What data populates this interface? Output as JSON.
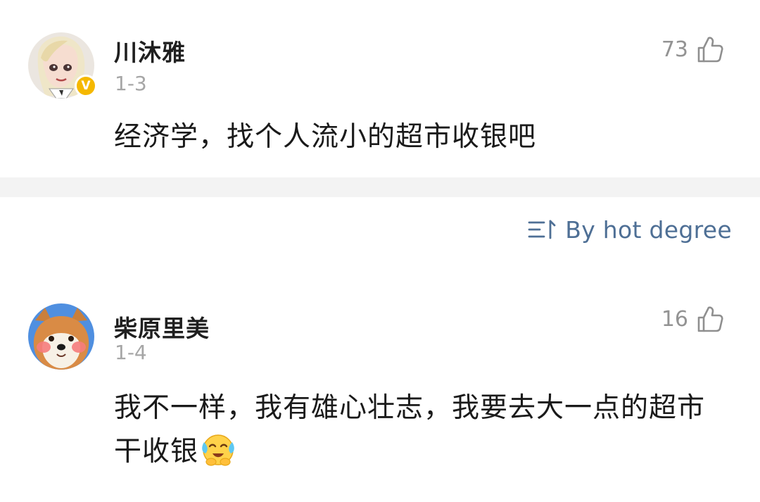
{
  "comments": [
    {
      "username": "川沐雅",
      "date": "1-3",
      "likes": "73",
      "verified_badge": "V",
      "content": "经济学，找个人流小的超市收银吧",
      "avatar": "anime-girl-avatar",
      "emoji": null
    },
    {
      "username": "柴原里美",
      "date": "1-4",
      "likes": "16",
      "verified_badge": null,
      "content": "我不一样，我有雄心壮志，我要去大一点的超市干收银",
      "avatar": "shiba-dog-avatar",
      "emoji": "crying-smile-emoji"
    }
  ],
  "sort": {
    "label": "By hot degree",
    "icon": "sort-icon",
    "color": "#4e6f95"
  },
  "icons": {
    "like": "thumbs-up-outline-icon"
  },
  "colors": {
    "divider": "#f3f3f3",
    "verified_badge": "#f5b800",
    "meta_text": "#a6a6a6"
  }
}
